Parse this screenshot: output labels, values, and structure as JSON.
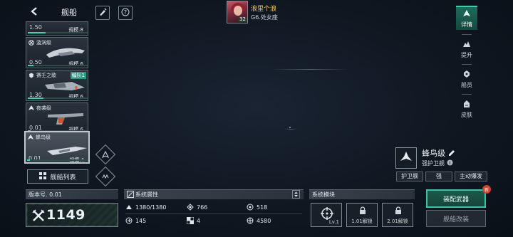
{
  "header": {
    "title": "舰船"
  },
  "player": {
    "name": "浪里个浪",
    "sub": "G6.处女座",
    "level": "32"
  },
  "ships": [
    {
      "name": "",
      "version": "1.50",
      "scale": "规模.8",
      "progress": 0.3
    },
    {
      "name": "漩涡级",
      "version": "0.50",
      "scale": "规模.6",
      "progress": 0.1
    },
    {
      "name": "赛壬之歌",
      "version": "1.30",
      "scale": "规模.6",
      "progress": 0.26,
      "tag": "编队1"
    },
    {
      "name": "夜袭级",
      "version": "0.01",
      "scale": "规模.6",
      "progress": 0.05
    },
    {
      "name": "蜂鸟级",
      "version": "0.01",
      "scale": "规模.4",
      "progress": 0.05,
      "selected": true
    }
  ],
  "fleet_list": {
    "label": "舰船列表"
  },
  "version": {
    "label": "版本号. 0.01"
  },
  "power": {
    "value": "1149"
  },
  "attributes": {
    "title": "系统属性",
    "items": [
      {
        "value": "1380/1380",
        "icon": "hull-icon"
      },
      {
        "value": "766",
        "icon": "armor-icon"
      },
      {
        "value": "518",
        "icon": "shield-icon"
      },
      {
        "value": "145",
        "icon": "speed-icon"
      },
      {
        "value": "4",
        "icon": "slot-icon"
      },
      {
        "value": "4580",
        "icon": "range-icon"
      }
    ]
  },
  "modules": {
    "title": "系统模块",
    "items": [
      {
        "label": "Lv.1"
      },
      {
        "label": "1.01解锁"
      },
      {
        "label": "2.01解锁"
      }
    ]
  },
  "tabs": [
    {
      "label": "详情",
      "icon": "detail-icon",
      "active": true
    },
    {
      "label": "提升",
      "icon": "upgrade-icon"
    },
    {
      "label": "船员",
      "icon": "crew-icon"
    },
    {
      "label": "皮肤",
      "icon": "skin-icon"
    }
  ],
  "ship_info": {
    "name": "蜂鸟级",
    "type": "强护卫舰",
    "tags": [
      "护卫舰",
      "强",
      "主动爆发"
    ]
  },
  "actions": {
    "equip": "装配武器",
    "refit": "舰船改装",
    "new_badge": "新"
  },
  "colors": {
    "accent": "#3fd2b2",
    "gold": "#f0c860",
    "alert": "#d4402b"
  }
}
